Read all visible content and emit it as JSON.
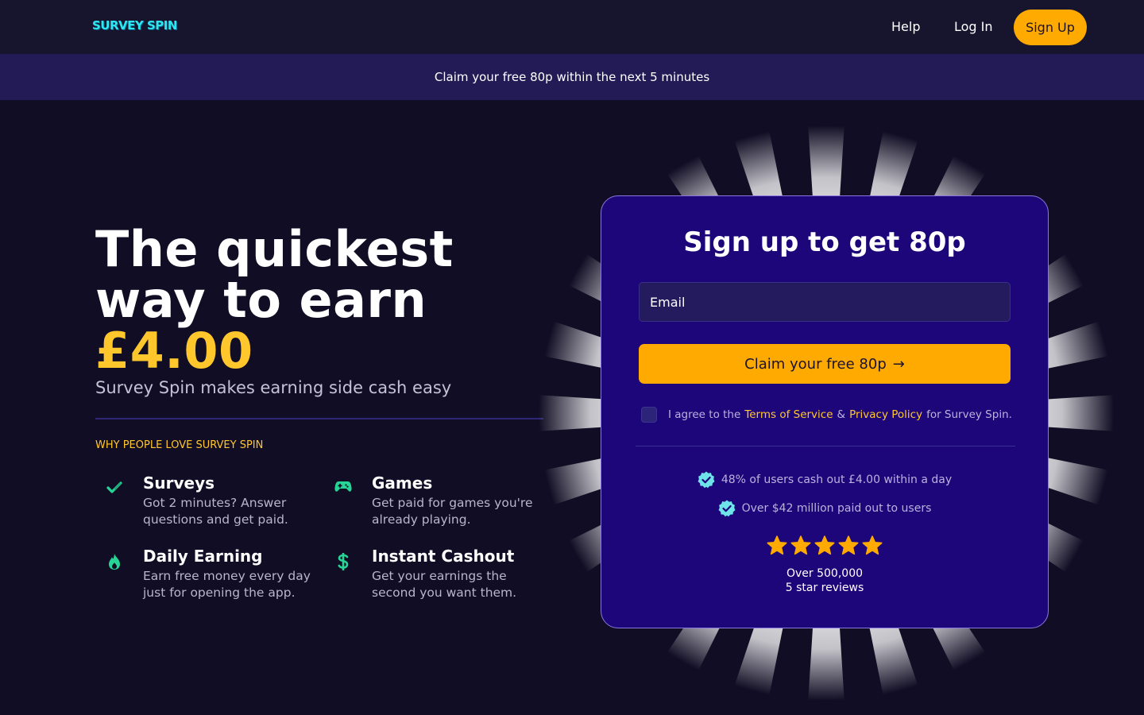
{
  "nav": {
    "logo": "SURVEY SPIN",
    "help": "Help",
    "login": "Log In",
    "signup": "Sign Up"
  },
  "banner": {
    "text": "Claim your free 80p within the next 5 minutes"
  },
  "hero": {
    "title_line1": "The quickest",
    "title_line2": "way to earn",
    "amount": "£4.00",
    "subtitle": "Survey Spin makes earning side cash easy",
    "why_label": "WHY PEOPLE LOVE SURVEY SPIN"
  },
  "features": [
    {
      "icon": "check-icon",
      "title": "Surveys",
      "desc": "Got 2 minutes? Answer questions and get paid."
    },
    {
      "icon": "gamepad-icon",
      "title": "Games",
      "desc": "Get paid for games you're already playing."
    },
    {
      "icon": "flame-icon",
      "title": "Daily Earning",
      "desc": "Earn free money every day just for opening the app."
    },
    {
      "icon": "dollar-icon",
      "title": "Instant Cashout",
      "desc": "Get your earnings the second you want them."
    }
  ],
  "signup_card": {
    "title": "Sign up to get 80p",
    "email_placeholder": "Email",
    "claim_button": "Claim your free 80p",
    "claim_arrow": "→",
    "agree_prefix": "I agree to the",
    "terms_link": "Terms of Service",
    "amp": "&",
    "privacy_link": "Privacy Policy",
    "agree_suffix": "for Survey Spin.",
    "stat_1": "48% of users cash out £4.00 within a day",
    "stat_2": "Over $42 million paid out to users",
    "rating_stars": 5,
    "reviews_line1": "Over 500,000",
    "reviews_line2": "5 star reviews"
  },
  "colors": {
    "background": "#110d24",
    "nav": "#17152e",
    "banner": "#231b56",
    "card": "#1d0679",
    "accent_orange": "#ffaa00",
    "accent_yellow": "#ffc72c",
    "logo_cyan": "#2ee6f0",
    "feature_icon_green": "#26d596"
  }
}
